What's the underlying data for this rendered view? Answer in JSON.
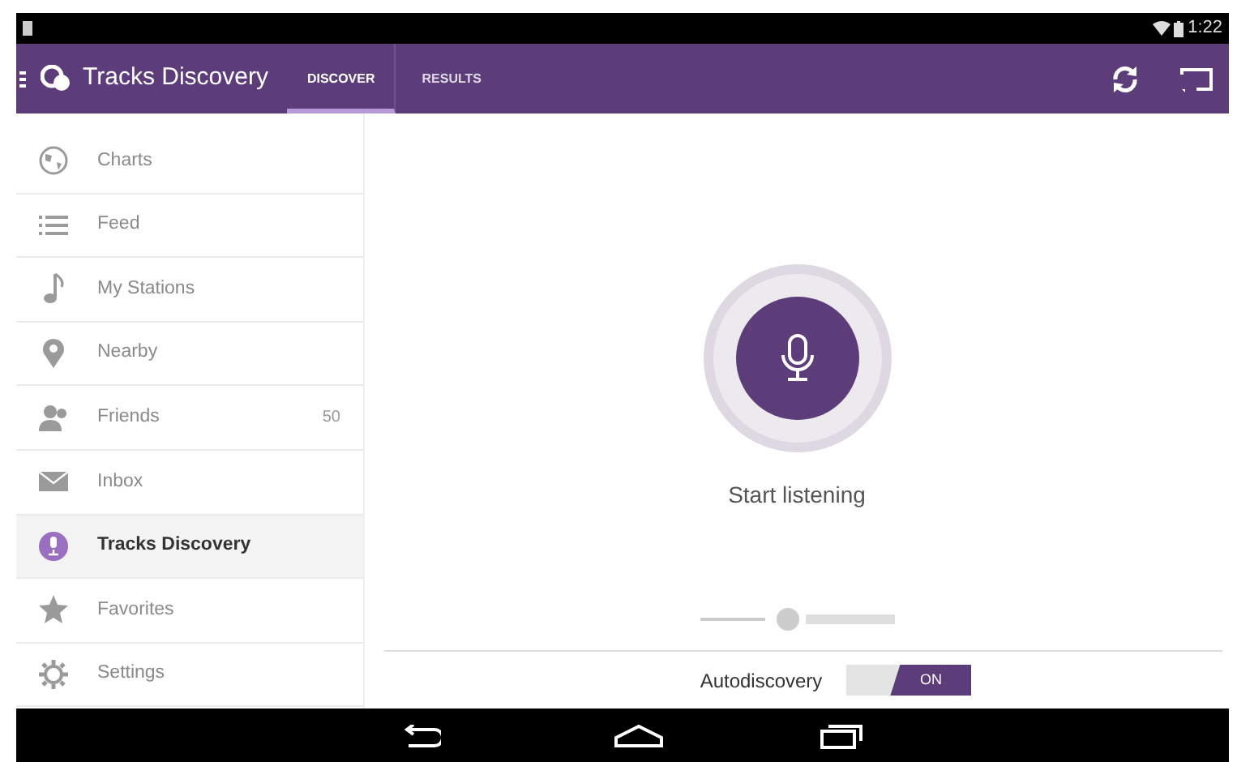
{
  "status_bar": {
    "time": "1:22"
  },
  "app_bar": {
    "title": "Tracks Discovery",
    "tabs": [
      {
        "label": "DISCOVER",
        "selected": true
      },
      {
        "label": "RESULTS",
        "selected": false
      }
    ]
  },
  "sidebar": {
    "items": [
      {
        "label": "Charts",
        "selected": false
      },
      {
        "label": "Feed",
        "selected": false
      },
      {
        "label": "My Stations",
        "selected": false
      },
      {
        "label": "Nearby",
        "selected": false
      },
      {
        "label": "Friends",
        "count": "50",
        "selected": false
      },
      {
        "label": "Inbox",
        "selected": false
      },
      {
        "label": "Tracks Discovery",
        "selected": true
      },
      {
        "label": "Favorites",
        "selected": false
      },
      {
        "label": "Settings",
        "selected": false
      }
    ]
  },
  "main": {
    "prompt": "Start listening",
    "autodiscovery": {
      "label": "Autodiscovery",
      "on": true,
      "state_label": "ON"
    }
  }
}
